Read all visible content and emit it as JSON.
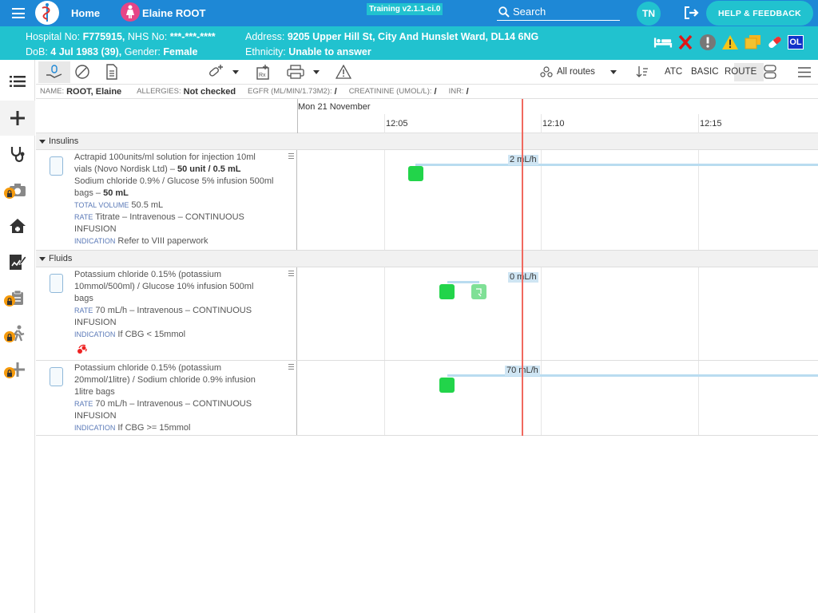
{
  "topbar": {
    "home": "Home",
    "patient_name": "Elaine ROOT",
    "training": "Training v2.1.1-ci.0",
    "search": "Search",
    "user_initials": "TN",
    "help": "HELP & FEEDBACK"
  },
  "banner": {
    "hospital_label": "Hospital No:",
    "hospital_no": "F775915,",
    "nhs_label": "NHS No:",
    "nhs_no": "***-***-****",
    "dob_label": "DoB:",
    "dob": "4 Jul 1983 (39),",
    "gender_label": "Gender:",
    "gender": "Female",
    "address_label": "Address:",
    "address": "9205 Upper Hill St, City And Hunslet Ward, DL14 6NG",
    "ethnicity_label": "Ethnicity:",
    "ethnicity": "Unable to answer",
    "ol": "OL"
  },
  "toolbar": {
    "routes": "All routes",
    "atc": "ATC",
    "basic": "BASIC",
    "route": "ROUTE"
  },
  "infobar": {
    "name_label": "NAME:",
    "name": "ROOT, Elaine",
    "allergies_label": "ALLERGIES:",
    "allergies": "Not checked",
    "egfr_label": "EGFR (ML/MIN/1.73M2):",
    "egfr": "/",
    "creat_label": "CREATININE (UMOL/L):",
    "creat": "/",
    "inr_label": "INR:",
    "inr": "/"
  },
  "timeline": {
    "date": "Mon 21 November",
    "times": [
      "12:05",
      "12:10",
      "12:15"
    ]
  },
  "sections": [
    {
      "name": "Insulins",
      "rows": [
        {
          "line1": "Actrapid 100units/ml solution for injection 10ml vials (Novo Nordisk Ltd) – ",
          "dose1": "50 unit / 0.5 mL",
          "line2": "Sodium chloride 0.9% / Glucose 5% infusion 500ml bags – ",
          "dose2": "50 mL",
          "tv_label": "TOTAL VOLUME",
          "tv": "50.5 mL",
          "rate_label": "RATE",
          "rate": "Titrate – Intravenous – CONTINUOUS INFUSION",
          "ind_label": "INDICATION",
          "ind": "Refer to VIII paperwork",
          "rate_badge": "2 mL/h"
        }
      ]
    },
    {
      "name": "Fluids",
      "rows": [
        {
          "line1": "Potassium chloride 0.15% (potassium 10mmol/500ml) / Glucose 10% infusion 500ml bags",
          "rate_label": "RATE",
          "rate": "70 mL/h – Intravenous – CONTINUOUS INFUSION",
          "ind_label": "INDICATION",
          "ind": "If CBG < 15mmol",
          "rate_badge": "0 mL/h"
        },
        {
          "line1": "Potassium chloride 0.15% (potassium 20mmol/1litre) / Sodium chloride 0.9% infusion 1litre bags",
          "rate_label": "RATE",
          "rate": "70 mL/h – Intravenous – CONTINUOUS INFUSION",
          "ind_label": "INDICATION",
          "ind": "If CBG >= 15mmol",
          "rate_badge": "70 mL/h"
        }
      ]
    }
  ],
  "colors": {
    "topbar": "#1e88d6",
    "banner": "#21c2cf",
    "given": "#22d44a",
    "now_line": "#f0695f"
  }
}
